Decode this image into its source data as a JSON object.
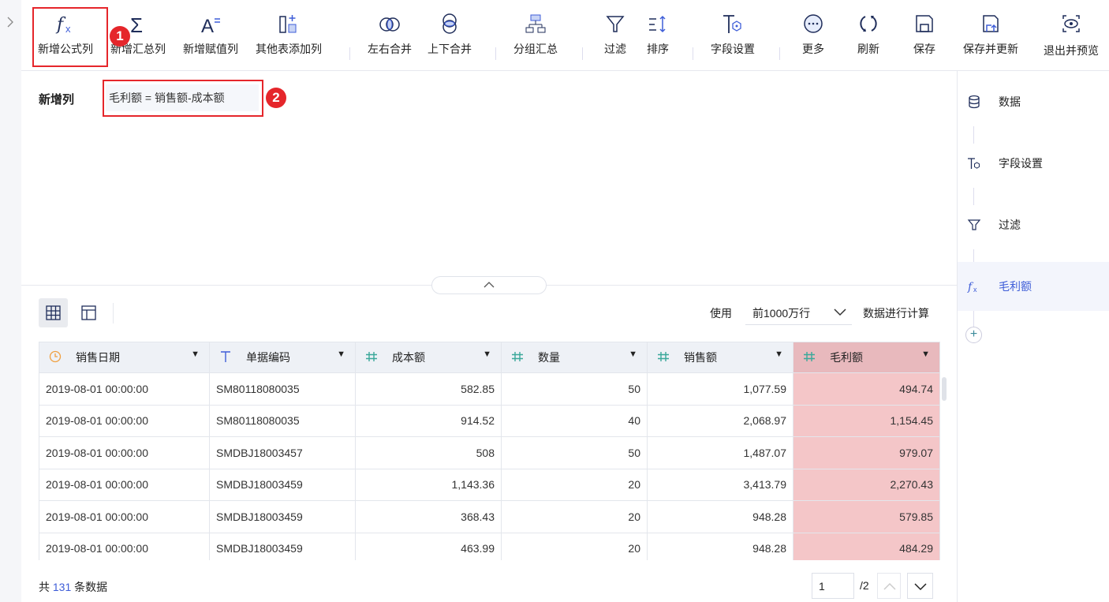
{
  "toolbar": {
    "items": [
      {
        "label": "新增公式列",
        "icon": "fx-icon"
      },
      {
        "label": "新增汇总列",
        "icon": "sigma-icon"
      },
      {
        "label": "新增赋值列",
        "icon": "assign-icon"
      },
      {
        "label": "其他表添加列",
        "icon": "add-column-icon"
      },
      {
        "label": "左右合并",
        "icon": "merge-horizontal-icon"
      },
      {
        "label": "上下合并",
        "icon": "merge-vertical-icon"
      },
      {
        "label": "分组汇总",
        "icon": "group-icon"
      },
      {
        "label": "过滤",
        "icon": "filter-icon"
      },
      {
        "label": "排序",
        "icon": "sort-icon"
      },
      {
        "label": "字段设置",
        "icon": "field-settings-icon"
      },
      {
        "label": "更多",
        "icon": "more-icon"
      },
      {
        "label": "刷新",
        "icon": "refresh-icon"
      },
      {
        "label": "保存",
        "icon": "save-icon"
      },
      {
        "label": "保存并更新",
        "icon": "save-update-icon"
      },
      {
        "label": "退出并预览",
        "icon": "preview-icon"
      }
    ]
  },
  "annotations": {
    "one": "1",
    "two": "2"
  },
  "formula": {
    "label": "新增列",
    "value": "毛利额 = 销售额-成本额"
  },
  "table_toolbar": {
    "use": "使用",
    "rows_option": "前1000万行",
    "compute": "数据进行计算"
  },
  "table": {
    "columns": [
      {
        "name": "销售日期",
        "type": "date"
      },
      {
        "name": "单据编码",
        "type": "text"
      },
      {
        "name": "成本额",
        "type": "number"
      },
      {
        "name": "数量",
        "type": "number"
      },
      {
        "name": "销售额",
        "type": "number"
      },
      {
        "name": "毛利额",
        "type": "number"
      }
    ],
    "rows": [
      [
        "2019-08-01 00:00:00",
        "SM80118080035",
        "582.85",
        "50",
        "1,077.59",
        "494.74"
      ],
      [
        "2019-08-01 00:00:00",
        "SM80118080035",
        "914.52",
        "40",
        "2,068.97",
        "1,154.45"
      ],
      [
        "2019-08-01 00:00:00",
        "SMDBJ18003457",
        "508",
        "50",
        "1,487.07",
        "979.07"
      ],
      [
        "2019-08-01 00:00:00",
        "SMDBJ18003459",
        "1,143.36",
        "20",
        "3,413.79",
        "2,270.43"
      ],
      [
        "2019-08-01 00:00:00",
        "SMDBJ18003459",
        "368.43",
        "20",
        "948.28",
        "579.85"
      ],
      [
        "2019-08-01 00:00:00",
        "SMDBJ18003459",
        "463.99",
        "20",
        "948.28",
        "484.29"
      ]
    ]
  },
  "footer": {
    "prefix": "共",
    "count": "131",
    "suffix": "条数据",
    "page": "1",
    "total_pages": "/2"
  },
  "right_panel": {
    "items": [
      {
        "label": "数据"
      },
      {
        "label": "字段设置"
      },
      {
        "label": "过滤"
      },
      {
        "label": "毛利额"
      }
    ]
  },
  "colors": {
    "accent": "#3f5ed8",
    "highlight": "#f4c6c8",
    "annotation": "#e5262b"
  }
}
